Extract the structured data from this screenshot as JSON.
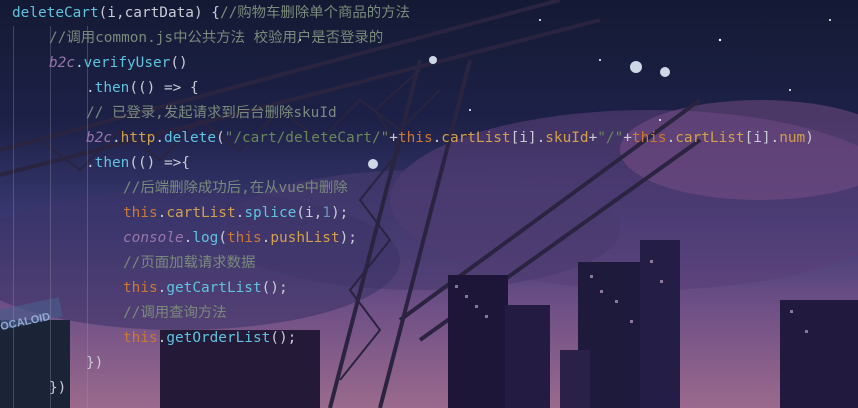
{
  "editor": {
    "lines": [
      {
        "indent": 0,
        "tokens": [
          {
            "t": "deleteCart",
            "c": "c-fn"
          },
          {
            "t": "(i,cartData) {",
            "c": "c-punc"
          },
          {
            "t": "//购物车删除单个商品的方法",
            "c": "c-comment"
          }
        ]
      },
      {
        "indent": 1,
        "tokens": [
          {
            "t": "//调用common.js中公共方法 校验用户是否登录的",
            "c": "c-comment"
          }
        ]
      },
      {
        "indent": 1,
        "tokens": [
          {
            "t": "b2c",
            "c": "c-obj"
          },
          {
            "t": ".",
            "c": "c-punc"
          },
          {
            "t": "verifyUser",
            "c": "c-method"
          },
          {
            "t": "()",
            "c": "c-punc"
          }
        ]
      },
      {
        "indent": 2,
        "tokens": [
          {
            "t": ".",
            "c": "c-punc"
          },
          {
            "t": "then",
            "c": "c-method"
          },
          {
            "t": "(() => {",
            "c": "c-punc"
          }
        ]
      },
      {
        "indent": 2,
        "tokens": [
          {
            "t": "// 已登录,发起请求到后台删除skuId",
            "c": "c-comment"
          }
        ]
      },
      {
        "indent": 2,
        "tokens": [
          {
            "t": "b2c",
            "c": "c-obj"
          },
          {
            "t": ".",
            "c": "c-punc"
          },
          {
            "t": "http",
            "c": "c-prop"
          },
          {
            "t": ".",
            "c": "c-punc"
          },
          {
            "t": "delete",
            "c": "c-method"
          },
          {
            "t": "(",
            "c": "c-punc"
          },
          {
            "t": "\"/cart/deleteCart/\"",
            "c": "c-str"
          },
          {
            "t": "+",
            "c": "c-punc"
          },
          {
            "t": "this",
            "c": "c-kw"
          },
          {
            "t": ".",
            "c": "c-punc"
          },
          {
            "t": "cartList",
            "c": "c-prop"
          },
          {
            "t": "[i].",
            "c": "c-punc"
          },
          {
            "t": "skuId",
            "c": "c-prop"
          },
          {
            "t": "+",
            "c": "c-punc"
          },
          {
            "t": "\"/\"",
            "c": "c-str"
          },
          {
            "t": "+",
            "c": "c-punc"
          },
          {
            "t": "this",
            "c": "c-kw"
          },
          {
            "t": ".",
            "c": "c-punc"
          },
          {
            "t": "cartList",
            "c": "c-prop"
          },
          {
            "t": "[i].",
            "c": "c-punc"
          },
          {
            "t": "num",
            "c": "c-prop"
          },
          {
            "t": ")",
            "c": "c-punc"
          }
        ]
      },
      {
        "indent": 2,
        "tokens": [
          {
            "t": ".",
            "c": "c-punc"
          },
          {
            "t": "then",
            "c": "c-method"
          },
          {
            "t": "(() =>{",
            "c": "c-punc"
          }
        ]
      },
      {
        "indent": 3,
        "tokens": [
          {
            "t": "//后端删除成功后,在从vue中删除",
            "c": "c-comment"
          }
        ]
      },
      {
        "indent": 3,
        "tokens": [
          {
            "t": "this",
            "c": "c-kw"
          },
          {
            "t": ".",
            "c": "c-punc"
          },
          {
            "t": "cartList",
            "c": "c-prop"
          },
          {
            "t": ".",
            "c": "c-punc"
          },
          {
            "t": "splice",
            "c": "c-method"
          },
          {
            "t": "(i,",
            "c": "c-punc"
          },
          {
            "t": "1",
            "c": "c-num"
          },
          {
            "t": ");",
            "c": "c-punc"
          }
        ]
      },
      {
        "indent": 3,
        "tokens": [
          {
            "t": "console",
            "c": "c-obj"
          },
          {
            "t": ".",
            "c": "c-punc"
          },
          {
            "t": "log",
            "c": "c-method"
          },
          {
            "t": "(",
            "c": "c-punc"
          },
          {
            "t": "this",
            "c": "c-kw"
          },
          {
            "t": ".",
            "c": "c-punc"
          },
          {
            "t": "pushList",
            "c": "c-prop"
          },
          {
            "t": ");",
            "c": "c-punc"
          }
        ]
      },
      {
        "indent": 3,
        "tokens": [
          {
            "t": "//页面加载请求数据",
            "c": "c-comment"
          }
        ]
      },
      {
        "indent": 3,
        "tokens": [
          {
            "t": "this",
            "c": "c-kw"
          },
          {
            "t": ".",
            "c": "c-punc"
          },
          {
            "t": "getCartList",
            "c": "c-method"
          },
          {
            "t": "();",
            "c": "c-punc"
          }
        ]
      },
      {
        "indent": 3,
        "tokens": [
          {
            "t": "//调用查询方法",
            "c": "c-comment"
          }
        ]
      },
      {
        "indent": 3,
        "tokens": [
          {
            "t": "this",
            "c": "c-kw"
          },
          {
            "t": ".",
            "c": "c-punc"
          },
          {
            "t": "getOrderList",
            "c": "c-method"
          },
          {
            "t": "();",
            "c": "c-punc"
          }
        ]
      },
      {
        "indent": 2,
        "tokens": [
          {
            "t": "})",
            "c": "c-punc"
          }
        ]
      },
      {
        "indent": 1,
        "tokens": [
          {
            "t": "})",
            "c": "c-punc"
          }
        ]
      }
    ]
  },
  "colors": {
    "background_tint": "#1b1733",
    "comment": "#7a8a7a",
    "keyword": "#cc7832",
    "string": "#6a8759",
    "property": "#d3a04a",
    "method": "#5fc3e0",
    "number": "#6897bb"
  },
  "background_sign": "OCALOID"
}
